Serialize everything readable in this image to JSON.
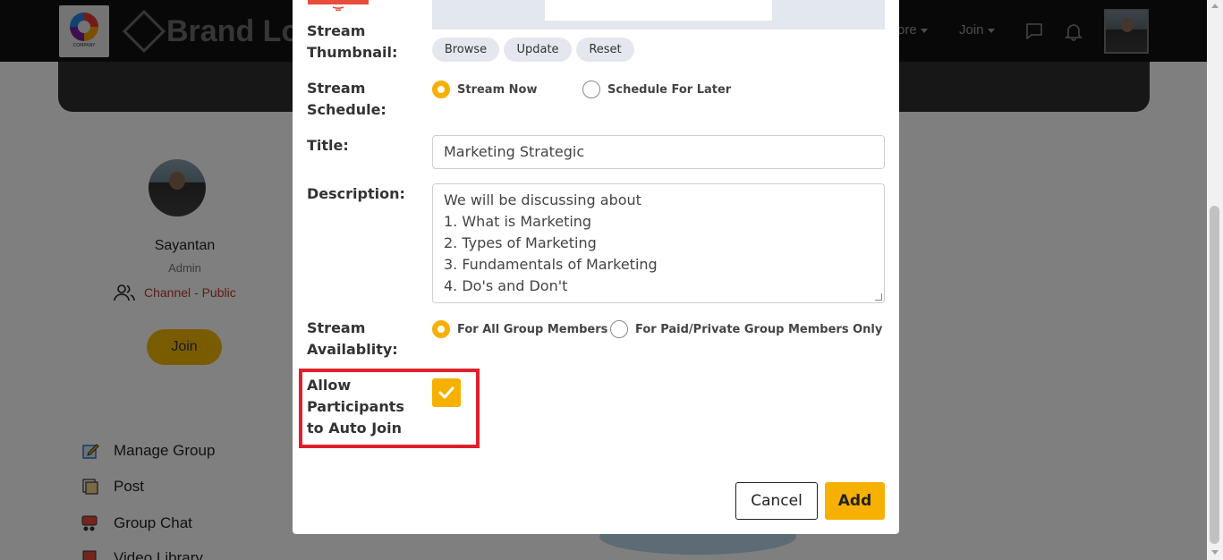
{
  "colors": {
    "accent": "#f5b000",
    "highlight_border": "#e0202b",
    "topbar": "#111111",
    "channel_text": "#c0392b"
  },
  "topbar": {
    "logo_caption": "COMPANY",
    "brand_text": "Brand Log",
    "nav_more": "ore",
    "nav_join": "Join",
    "icons": [
      "chat-icon",
      "bell-icon"
    ]
  },
  "profile": {
    "name": "Sayantan",
    "role": "Admin",
    "channel": "Channel - Public",
    "join_label": "Join"
  },
  "menu": {
    "items": [
      {
        "label": "Manage Group",
        "icon": "edit-icon"
      },
      {
        "label": "Post",
        "icon": "post-icon"
      },
      {
        "label": "Group Chat",
        "icon": "group-chat-icon"
      },
      {
        "label": "Video Library",
        "icon": "video-library-icon"
      }
    ]
  },
  "modal": {
    "thumbnail_label": "Stream Thumbnail:",
    "thumbnail_buttons": {
      "browse": "Browse",
      "update": "Update",
      "reset": "Reset"
    },
    "schedule_label": "Stream Schedule:",
    "schedule_options": {
      "now": "Stream Now",
      "later": "Schedule For Later",
      "selected": "Stream Now"
    },
    "title_label": "Title:",
    "title_value": "Marketing Strategic",
    "description_label": "Description:",
    "description_lines": [
      "We will be discussing about",
      "1. What is Marketing",
      "2. Types of Marketing",
      "3. Fundamentals of Marketing",
      "4. Do's and Don't"
    ],
    "availability_label": "Stream Availablity:",
    "availability_options": {
      "all": "For All Group Members",
      "paid": "For Paid/Private Group Members Only",
      "selected": "For All Group Members"
    },
    "auto_join_label": "Allow Participants to Auto Join",
    "auto_join_checked": true,
    "cancel_label": "Cancel",
    "add_label": "Add"
  }
}
